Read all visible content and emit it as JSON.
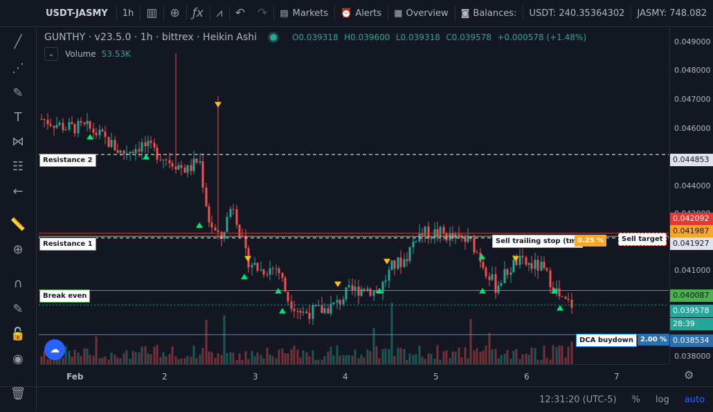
{
  "toolbar": {
    "symbol": "USDT-JASMY",
    "interval": "1h",
    "markets": "Markets",
    "alerts": "Alerts",
    "overview": "Overview",
    "balances": "Balances:",
    "usdt_balance": "USDT: 240.35364302",
    "jasmy_balance": "JASMY: 748.082"
  },
  "legend": {
    "title": "GUNTHY · v23.5.0 · 1h · bittrex · Heikin Ashi",
    "open": "O0.039318",
    "high": "H0.039600",
    "low": "L0.039318",
    "close": "C0.039578",
    "change": "+0.000578 (+1.48%)",
    "volume_label": "Volume",
    "volume_value": "53.53K"
  },
  "price_ticks": [
    "0.049000",
    "0.048000",
    "0.047000",
    "0.046000",
    "0.044000",
    "0.042000",
    "0.041000",
    "0.038000"
  ],
  "price_labels": {
    "resistance2": "0.044853",
    "sell_target": "0.042092",
    "trailing": "0.041987",
    "resistance1": "0.041927",
    "break_even": "0.040087",
    "last": "0.039578",
    "countdown": "28:39",
    "dca": "0.038534"
  },
  "hlines": {
    "resistance2": "Resistance 2",
    "resistance1": "Resistance 1",
    "break_even": "Break even",
    "sell_trailing": "Sell trailing stop (tm)",
    "sell_trailing_pct": "0.25 %",
    "sell_target": "Sell target",
    "dca": "DCA buydown",
    "dca_pct": "2.00 %"
  },
  "time_ticks": [
    "Feb",
    "2",
    "3",
    "4",
    "5",
    "6",
    "7"
  ],
  "bottom": {
    "clock": "12:31:20 (UTC-5)",
    "percent": "%",
    "log": "log",
    "auto": "auto"
  },
  "colors": {
    "bg": "#131722",
    "up": "#26a69a",
    "down": "#ef5350",
    "resistance": "#ffffff",
    "sell_target": "#e53935",
    "trailing": "#f9a825",
    "break_even": "#4caf50",
    "dca": "#2196f3",
    "last_line": "#26a69a"
  },
  "chart_data": {
    "type": "candlestick",
    "price_range": [
      0.0375,
      0.0493
    ],
    "signals": {
      "buy_markers": 17,
      "sell_markers": 6
    }
  }
}
